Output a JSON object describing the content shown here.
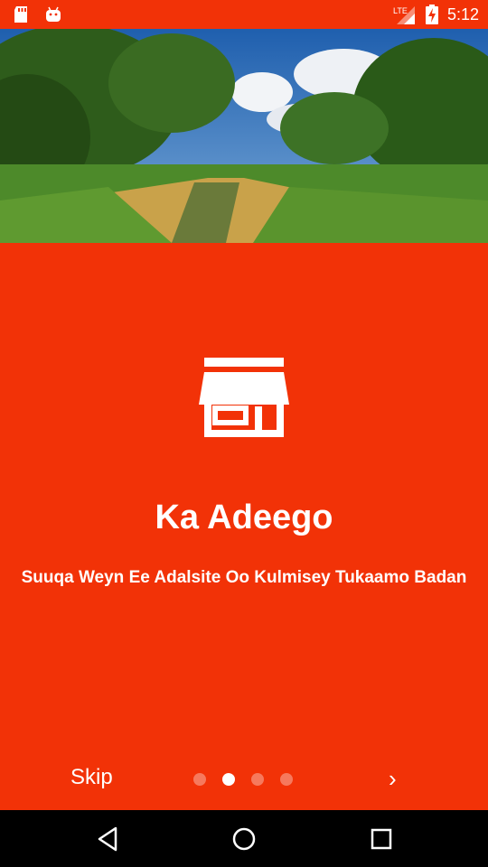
{
  "status_bar": {
    "time": "5:12",
    "network": "LTE",
    "icons": [
      "sd-card-icon",
      "android-icon",
      "signal-icon",
      "battery-charging-icon"
    ]
  },
  "hero": {
    "image": "landscape-photo"
  },
  "onboarding": {
    "icon": "store-icon",
    "title": "Ka Adeego",
    "subtitle": "Suuqa Weyn Ee Adalsite Oo Kulmisey Tukaamo Badan",
    "skip_label": "Skip",
    "next_label": "›",
    "page_count": 4,
    "current_page": 2
  },
  "nav_bar": {
    "icons": [
      "back-icon",
      "home-icon",
      "recents-icon"
    ]
  },
  "colors": {
    "accent": "#F23207",
    "text": "#FFFFFF",
    "nav_bg": "#000000"
  }
}
